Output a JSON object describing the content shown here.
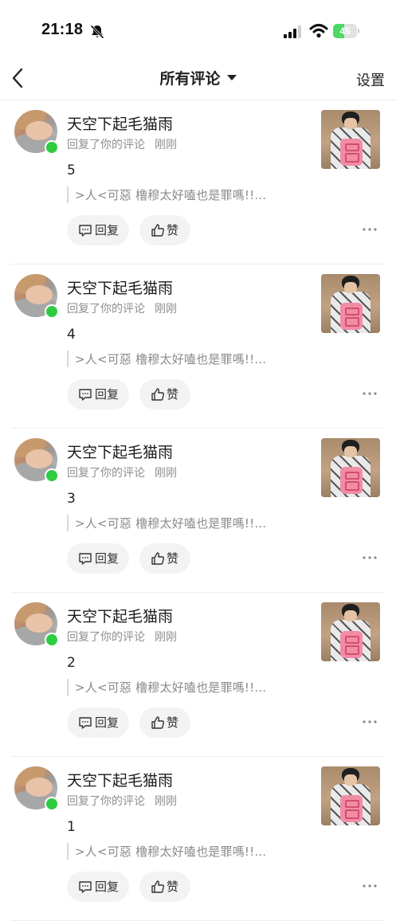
{
  "status_bar": {
    "time": "21:18",
    "battery_level": "45"
  },
  "nav": {
    "title": "所有评论",
    "settings_label": "设置"
  },
  "comments": [
    {
      "user_name": "天空下起毛猫雨",
      "action": "回复了你的评论",
      "time": "刚刚",
      "text": "5",
      "quote": ">⼈<可惡 橹穆太好嗑也是罪嗎!!...",
      "reply_label": "回复",
      "like_label": "赞"
    },
    {
      "user_name": "天空下起毛猫雨",
      "action": "回复了你的评论",
      "time": "刚刚",
      "text": "4",
      "quote": ">⼈<可惡 橹穆太好嗑也是罪嗎!!...",
      "reply_label": "回复",
      "like_label": "赞"
    },
    {
      "user_name": "天空下起毛猫雨",
      "action": "回复了你的评论",
      "time": "刚刚",
      "text": "3",
      "quote": ">⼈<可惡 橹穆太好嗑也是罪嗎!!...",
      "reply_label": "回复",
      "like_label": "赞"
    },
    {
      "user_name": "天空下起毛猫雨",
      "action": "回复了你的评论",
      "time": "刚刚",
      "text": "2",
      "quote": ">⼈<可惡 橹穆太好嗑也是罪嗎!!...",
      "reply_label": "回复",
      "like_label": "赞"
    },
    {
      "user_name": "天空下起毛猫雨",
      "action": "回复了你的评论",
      "time": "刚刚",
      "text": "1",
      "quote": ">⼈<可惡 橹穆太好嗑也是罪嗎!!...",
      "reply_label": "回复",
      "like_label": "赞"
    }
  ],
  "colors": {
    "online": "#2ecc40",
    "battery": "#4cd964",
    "button_bg": "#f3f3f3"
  }
}
